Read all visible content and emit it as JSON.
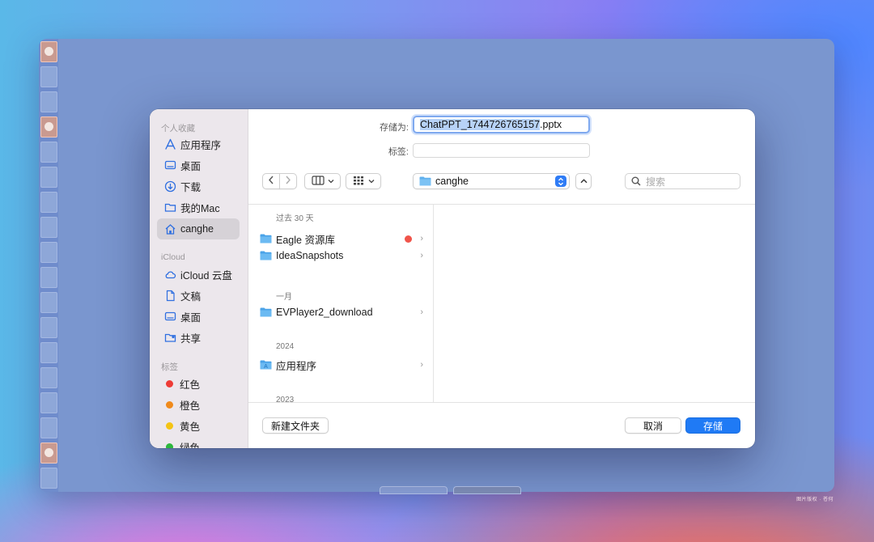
{
  "dialog": {
    "save_as_label": "存储为:",
    "filename_selected": "ChatPPT_1744726765157",
    "filename_ext": ".pptx",
    "tags_label": "标签:",
    "tags_value": "",
    "location": "canghe",
    "search_placeholder": "搜索",
    "new_folder_label": "新建文件夹",
    "cancel_label": "取消",
    "save_label": "存储"
  },
  "sidebar": {
    "favorites_header": "个人收藏",
    "favorites": [
      {
        "label": "应用程序",
        "icon": "applications-icon"
      },
      {
        "label": "桌面",
        "icon": "desktop-icon"
      },
      {
        "label": "下载",
        "icon": "downloads-icon"
      },
      {
        "label": "我的Mac",
        "icon": "folder-icon"
      },
      {
        "label": "canghe",
        "icon": "home-icon",
        "selected": true
      }
    ],
    "icloud_header": "iCloud",
    "icloud": [
      {
        "label": "iCloud 云盘",
        "icon": "cloud-icon"
      },
      {
        "label": "文稿",
        "icon": "document-icon"
      },
      {
        "label": "桌面",
        "icon": "desktop-icon"
      },
      {
        "label": "共享",
        "icon": "shared-folder-icon"
      }
    ],
    "tags_header": "标签",
    "tags": [
      {
        "label": "红色",
        "color": "#ee3b36"
      },
      {
        "label": "橙色",
        "color": "#f08a1b"
      },
      {
        "label": "黄色",
        "color": "#f4c414"
      },
      {
        "label": "绿色",
        "color": "#2db83d"
      }
    ]
  },
  "browser": {
    "groups": [
      {
        "header": "过去 30 天",
        "items": [
          {
            "name": "Eagle 资源库",
            "tag_color": "#f0544a"
          },
          {
            "name": "IdeaSnapshots"
          }
        ]
      },
      {
        "header": "一月",
        "items": [
          {
            "name": "EVPlayer2_download"
          }
        ]
      },
      {
        "header": "2024",
        "items": [
          {
            "name": "应用程序"
          }
        ]
      },
      {
        "header": "2023",
        "items": []
      }
    ]
  },
  "background": {
    "watermark": "图片版权 · 苍何"
  }
}
